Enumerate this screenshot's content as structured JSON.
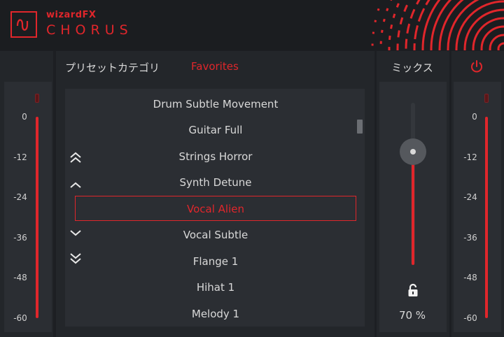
{
  "brand": {
    "top": "wizardFX",
    "name": "CHORUS"
  },
  "preset": {
    "category_label": "プリセットカテゴリ",
    "category_value": "Favorites",
    "items": [
      {
        "label": "Drum Subtle Movement"
      },
      {
        "label": "Guitar Full"
      },
      {
        "label": "Strings Horror"
      },
      {
        "label": "Synth Detune"
      },
      {
        "label": "Vocal Alien"
      },
      {
        "label": "Vocal Subtle"
      },
      {
        "label": "Flange 1"
      },
      {
        "label": "Hihat 1"
      },
      {
        "label": "Melody 1"
      }
    ],
    "selected_label": "Vocal Alien"
  },
  "meter_scale": [
    "0",
    "-12",
    "-24",
    "-36",
    "-48",
    "-60"
  ],
  "mix": {
    "label": "ミックス",
    "value_text": "70 %",
    "value": 0.7
  },
  "icons": [
    "chorus-logo-icon",
    "power-icon",
    "lock-icon",
    "double-chevron-up-icon",
    "chevron-up-icon",
    "chevron-down-icon",
    "double-chevron-down-icon"
  ],
  "colors": {
    "accent": "#e0262b",
    "background": "#1d1f23",
    "panel": "#23262a",
    "text": "#d9d9d9"
  }
}
